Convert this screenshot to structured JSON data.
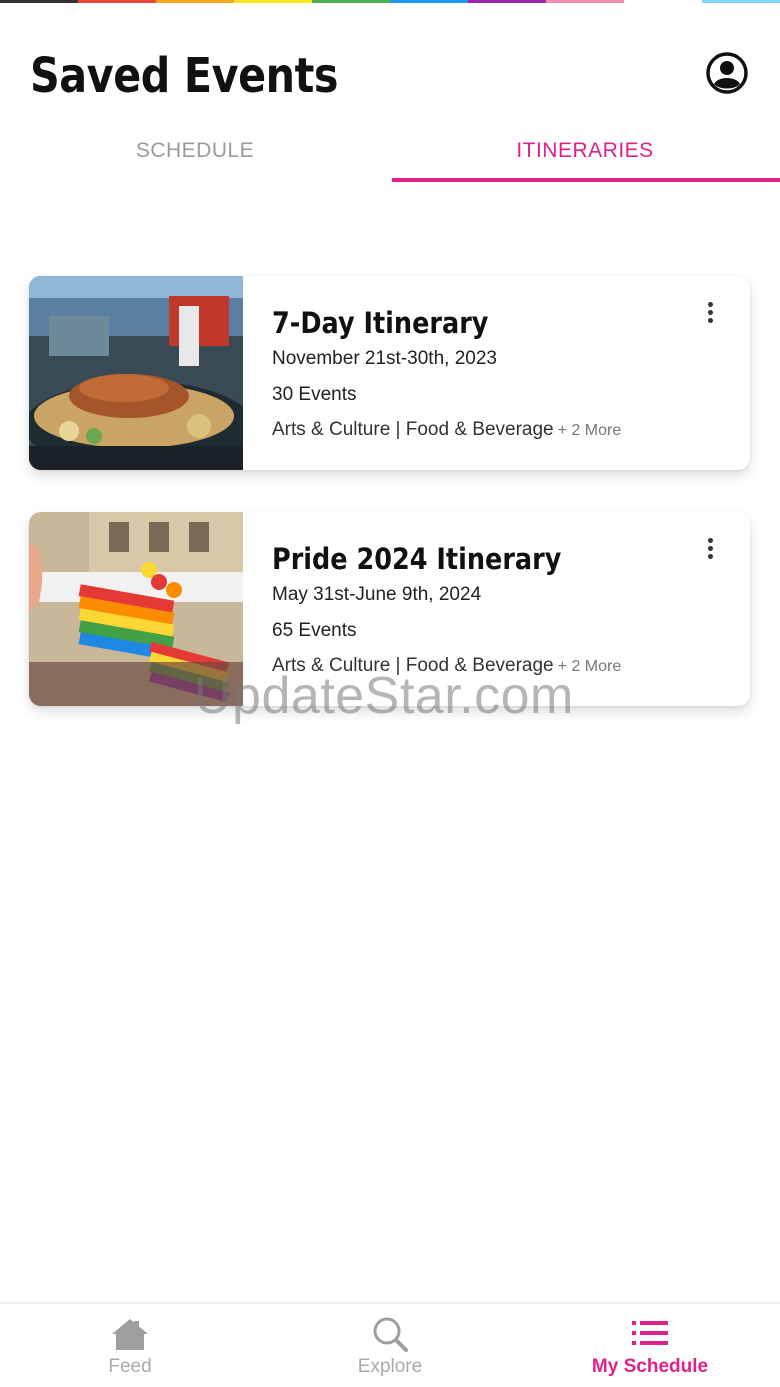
{
  "header": {
    "title": "Saved Events"
  },
  "tabs": [
    {
      "label": "SCHEDULE",
      "active": false
    },
    {
      "label": "ITINERARIES",
      "active": true
    }
  ],
  "itineraries": [
    {
      "title": "7-Day Itinerary",
      "dates": "November 21st-30th, 2023",
      "count": "30 Events",
      "tags": "Arts & Culture | Food & Beverage",
      "more": "+ 2 More",
      "image": "food-plate-photo"
    },
    {
      "title": "Pride 2024 Itinerary",
      "dates": "May 31st-June 9th, 2024",
      "count": "65 Events",
      "tags": "Arts & Culture | Food & Beverage",
      "more": "+ 2 More",
      "image": "pride-parade-photo"
    }
  ],
  "watermark": "UpdateStar.com",
  "nav": [
    {
      "label": "Feed",
      "icon": "home-icon",
      "active": false
    },
    {
      "label": "Explore",
      "icon": "search-icon",
      "active": false
    },
    {
      "label": "My Schedule",
      "icon": "list-icon",
      "active": true
    }
  ],
  "colors": {
    "accent": "#e0218a",
    "inactive": "#aaaaaa",
    "text": "#111111"
  }
}
